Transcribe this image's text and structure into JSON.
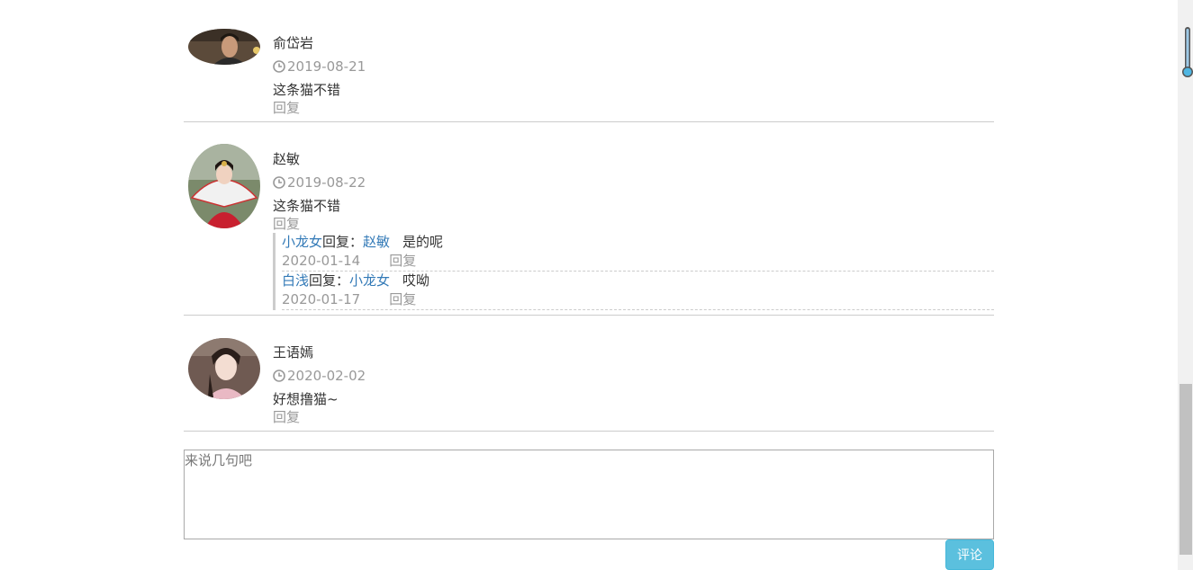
{
  "comments": [
    {
      "author": "俞岱岩",
      "date": "2019-08-21",
      "text": "这条猫不错",
      "reply_label": "回复",
      "avatar_icon": "portrait-man-icon"
    },
    {
      "author": "赵敏",
      "date": "2019-08-22",
      "text": "这条猫不错",
      "reply_label": "回复",
      "avatar_icon": "portrait-woman-fan-icon",
      "replies": [
        {
          "from": "小龙女",
          "verb": "回复：",
          "to": "赵敏",
          "content": "是的呢",
          "date": "2020-01-14",
          "reply_label": "回复"
        },
        {
          "from": "白浅",
          "verb": "回复：",
          "to": "小龙女",
          "content": "哎呦",
          "date": "2020-01-17",
          "reply_label": "回复"
        }
      ]
    },
    {
      "author": "王语嫣",
      "date": "2020-02-02",
      "text": "好想撸猫~",
      "reply_label": "回复",
      "avatar_icon": "portrait-woman-icon"
    }
  ],
  "composer": {
    "placeholder": "来说几句吧",
    "submit_label": "评论"
  },
  "colors": {
    "link": "#337ab7",
    "muted": "#999999",
    "button": "#5bc0de"
  }
}
